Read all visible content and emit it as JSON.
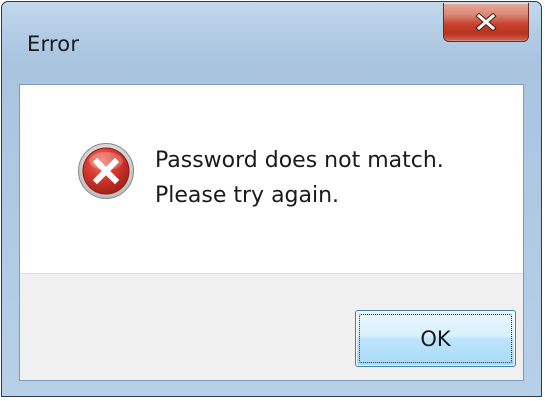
{
  "window": {
    "title": "Error",
    "close_icon": "close-icon"
  },
  "dialog": {
    "icon": "error-icon",
    "message_lines": [
      "Password does not match.",
      "Please try again."
    ],
    "ok_label": "OK"
  },
  "colors": {
    "accent_border": "#3c7fb1",
    "close_button_red": "#c9442f",
    "error_icon_red": "#c9332b",
    "frame": "#b3cde6"
  }
}
